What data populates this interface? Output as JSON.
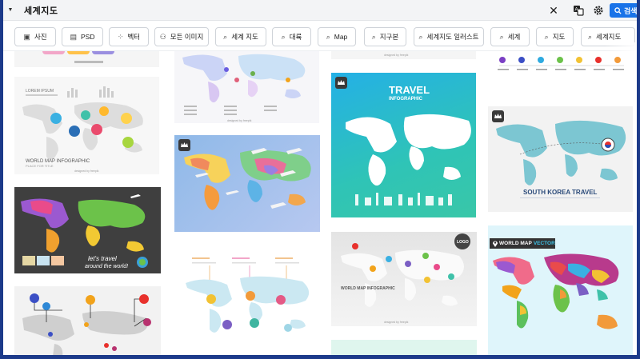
{
  "search": {
    "query": "세계지도",
    "button_label": "검색"
  },
  "chips": [
    {
      "label": "사진"
    },
    {
      "label": "PSD"
    },
    {
      "label": "벡터"
    },
    {
      "label": "모든 이미지"
    },
    {
      "label": "세계 지도"
    },
    {
      "label": "대륙"
    },
    {
      "label": "Map"
    },
    {
      "label": "지구본"
    },
    {
      "label": "세계지도 일러스트"
    },
    {
      "label": "세계"
    },
    {
      "label": "지도"
    },
    {
      "label": "세계지도"
    }
  ],
  "cards": {
    "c2": {
      "brand": "designed by freepik",
      "title": "LOREM IPSUM",
      "caption": "WORLD MAP INFOGRAPHIC",
      "sub": "PLACE FOR TITLE"
    },
    "c3": {
      "line1": "let's travel",
      "line2": "around the world!"
    },
    "c5": {
      "brand": "designed by freepik"
    },
    "c8": {
      "brand": "designed by freepik"
    },
    "c9": {
      "title": "TRAVEL",
      "subtitle": "INFOGRAPHIC"
    },
    "c10": {
      "title": "WORLD MAP INFOGRAPHIC",
      "logo": "LOGO",
      "brand": "designed by freepik"
    },
    "c13": {
      "title": "SOUTH KOREA TRAVEL"
    },
    "c14": {
      "title": "WORLD MAP",
      "accent": "VECTOR"
    }
  }
}
